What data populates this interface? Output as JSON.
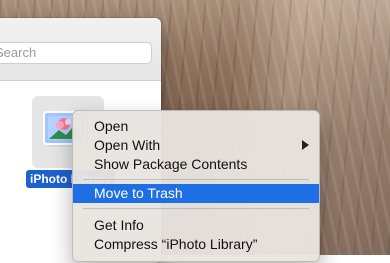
{
  "finder": {
    "search_placeholder": "Search",
    "selected_file_label": "iPhoto Library"
  },
  "context_menu": {
    "items": [
      {
        "label": "Open"
      },
      {
        "label": "Open With",
        "has_submenu": true
      },
      {
        "label": "Show Package Contents"
      },
      {
        "label": "Move to Trash",
        "highlighted": true
      },
      {
        "label": "Get Info"
      },
      {
        "label": "Compress “iPhoto Library”"
      }
    ]
  },
  "icons": {
    "file_icon": "iphoto-library-icon",
    "submenu_icon": "chevron-right-icon"
  },
  "colors": {
    "selection_blue": "#1e6fe3",
    "file_label_blue": "#1e62d0"
  }
}
